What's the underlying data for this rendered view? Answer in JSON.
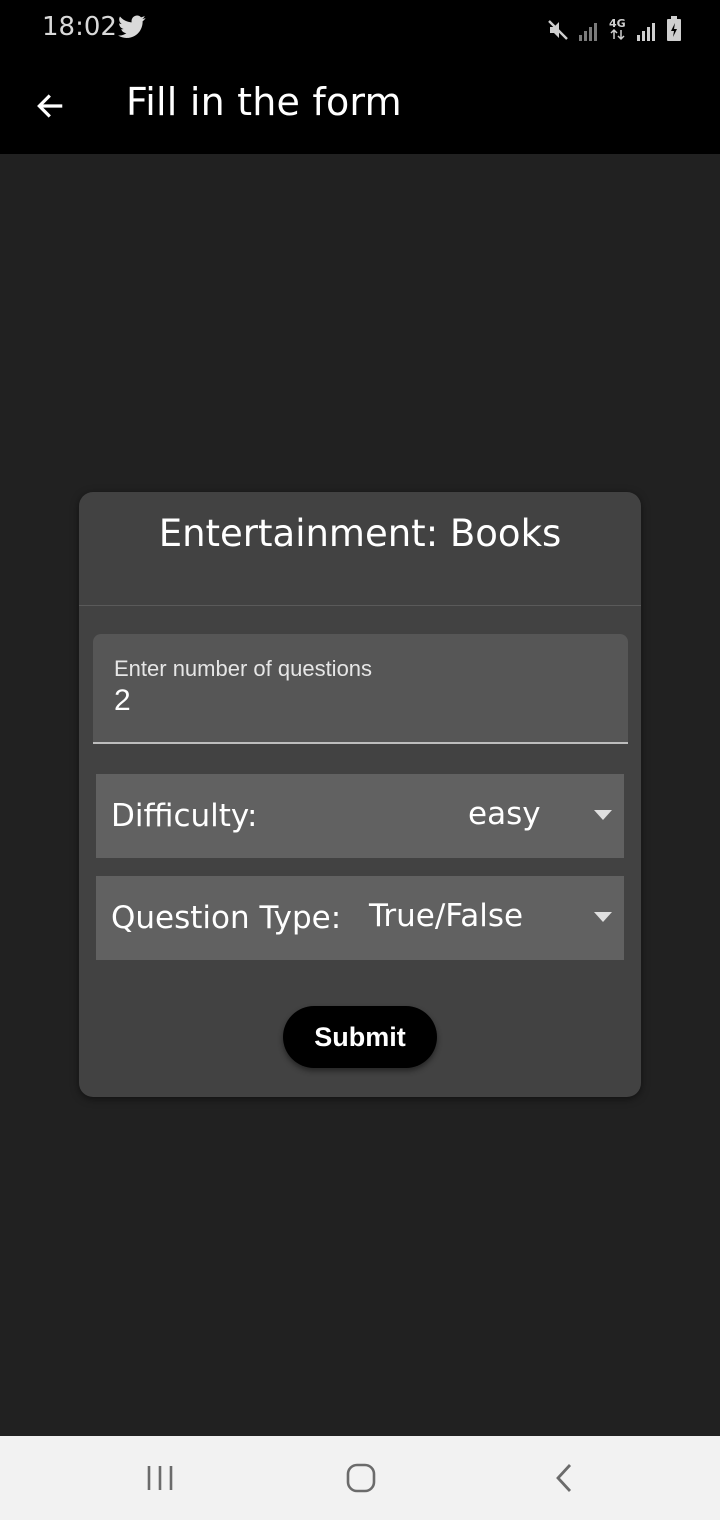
{
  "status_bar": {
    "time": "18:02",
    "icons": [
      "twitter-icon",
      "mute-icon",
      "signal-icon",
      "4g-icon",
      "signal-icon",
      "battery-charging-icon"
    ],
    "network_label": "4G"
  },
  "app_bar": {
    "title": "Fill in the form",
    "back_icon": "arrow-left-icon"
  },
  "form": {
    "category_title": "Entertainment: Books",
    "questions_field": {
      "label": "Enter number of questions",
      "value": "2"
    },
    "difficulty": {
      "label": "Difficulty:",
      "selected": "easy"
    },
    "question_type": {
      "label": "Question Type:",
      "selected": "True/False"
    },
    "submit_label": "Submit"
  },
  "nav_bar": {
    "buttons": [
      "recents-icon",
      "home-icon",
      "back-icon"
    ]
  },
  "colors": {
    "background": "#212121",
    "app_bar": "#000000",
    "card": "#424242",
    "field": "#565656",
    "select": "#616161",
    "nav_bar": "#f2f2f2"
  }
}
